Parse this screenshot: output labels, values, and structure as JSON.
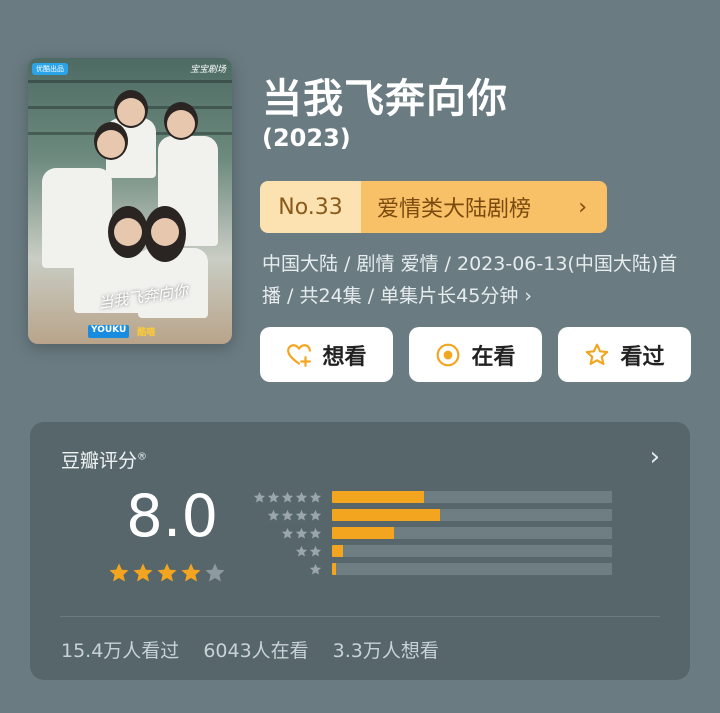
{
  "show": {
    "title": "当我飞奔向你",
    "year": "(2023)",
    "poster": {
      "badge": "优酷出品",
      "corner_mark": "宝宝剧场",
      "art_title": "当我飞奔向你",
      "logo_youku": "YOUKU",
      "logo_kumiao": "酷喵"
    }
  },
  "rank": {
    "number": "No.33",
    "category": "爱情类大陆剧榜"
  },
  "meta": {
    "text": "中国大陆 / 剧情 爱情 / 2023-06-13(中国大陆)首播 / 共24集 / 单集片长45分钟"
  },
  "actions": {
    "want": "想看",
    "watching": "在看",
    "watched": "看过"
  },
  "rating": {
    "label": "豆瓣评分",
    "mark": "®",
    "score": "8.0",
    "stars_filled": 4,
    "stars_total": 5,
    "distribution": [
      {
        "stars": 5,
        "fraction": 0.33
      },
      {
        "stars": 4,
        "fraction": 0.385
      },
      {
        "stars": 3,
        "fraction": 0.22
      },
      {
        "stars": 2,
        "fraction": 0.04
      },
      {
        "stars": 1,
        "fraction": 0.015
      }
    ],
    "stats": {
      "watched": "15.4万人看过",
      "watching": "6043人在看",
      "want": "3.3万人想看"
    }
  },
  "colors": {
    "background": "#6a7c82",
    "card": "#56666b",
    "accent": "#f4a520",
    "rank_pill_light": "#fbe2b0",
    "rank_pill": "#f8c067"
  },
  "icons": {
    "rank_arrow": "chevron-right-icon",
    "meta_arrow": "chevron-right-icon",
    "want": "heart-plus-icon",
    "watching": "target-icon",
    "watched": "star-outline-icon",
    "rating_arrow": "chevron-right-icon"
  }
}
